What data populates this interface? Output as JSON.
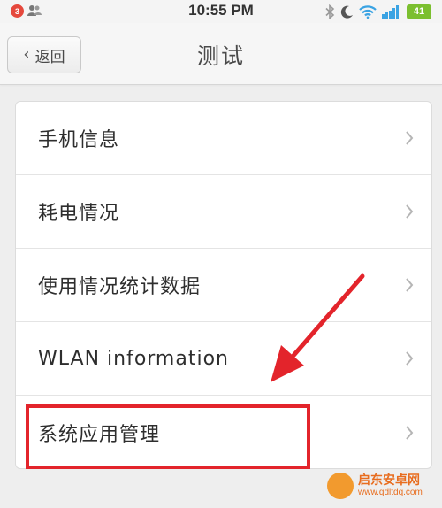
{
  "status_bar": {
    "notification_count": "3",
    "time": "10:55 PM",
    "battery": "41",
    "icons": [
      "contacts-icon",
      "bluetooth-icon",
      "moon-icon",
      "wifi-icon",
      "signal-icon"
    ]
  },
  "header": {
    "back_label": "返回",
    "title": "测试"
  },
  "list": {
    "items": [
      {
        "label": "手机信息"
      },
      {
        "label": "耗电情况"
      },
      {
        "label": "使用情况统计数据"
      },
      {
        "label": "WLAN information"
      },
      {
        "label": "系统应用管理"
      }
    ]
  },
  "annotation": {
    "highlight_color": "#e3242b",
    "highlighted_item": "系统应用管理"
  },
  "watermark": {
    "name": "启东安卓网",
    "url": "www.qdltdq.com"
  },
  "colors": {
    "background": "#eeeeee",
    "card": "#ffffff",
    "battery": "#7bbf2f",
    "badge": "#e5483c",
    "wifi": "#3aa3e3"
  }
}
